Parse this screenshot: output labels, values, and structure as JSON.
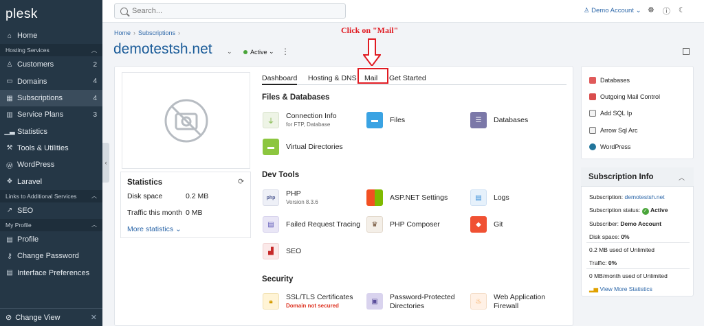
{
  "sidebar": {
    "logo": "plesk",
    "home": "Home",
    "sections": {
      "hosting": "Hosting Services",
      "links": "Links to Additional Services",
      "profile": "My Profile"
    },
    "items": [
      {
        "label": "Customers",
        "count": "2"
      },
      {
        "label": "Domains",
        "count": "4"
      },
      {
        "label": "Subscriptions",
        "count": "4"
      },
      {
        "label": "Service Plans",
        "count": "3"
      },
      {
        "label": "Statistics"
      },
      {
        "label": "Tools & Utilities"
      },
      {
        "label": "WordPress"
      },
      {
        "label": "Laravel"
      }
    ],
    "seo": "SEO",
    "profile_items": [
      "Profile",
      "Change Password",
      "Interface Preferences"
    ],
    "change_view": "Change View"
  },
  "topbar": {
    "search_placeholder": "Search...",
    "account": "Demo Account"
  },
  "breadcrumb": [
    "Home",
    "Subscriptions"
  ],
  "domain": "demotestsh.net",
  "status": "Active",
  "annotation": "Click on \"Mail\"",
  "tabs": [
    "Dashboard",
    "Hosting & DNS",
    "Mail",
    "Get Started"
  ],
  "statistics": {
    "title": "Statistics",
    "disk_label": "Disk space",
    "disk_value": "0.2 MB",
    "traffic_label": "Traffic this month",
    "traffic_value": "0 MB",
    "more": "More statistics"
  },
  "files_db": {
    "title": "Files & Databases",
    "tools": [
      {
        "label": "Connection Info",
        "sub": "for FTP, Database"
      },
      {
        "label": "Files"
      },
      {
        "label": "Databases"
      },
      {
        "label": "Virtual Directories"
      }
    ]
  },
  "dev_tools": {
    "title": "Dev Tools",
    "tools": [
      {
        "label": "PHP",
        "sub": "Version 8.3.6"
      },
      {
        "label": "ASP.NET Settings"
      },
      {
        "label": "Logs"
      },
      {
        "label": "Failed Request Tracing"
      },
      {
        "label": "PHP Composer"
      },
      {
        "label": "Git"
      },
      {
        "label": "SEO"
      }
    ]
  },
  "security": {
    "title": "Security",
    "tools": [
      {
        "label": "SSL/TLS Certificates",
        "sub": "Domain not secured"
      },
      {
        "label": "Password-Protected Directories"
      },
      {
        "label": "Web Application Firewall"
      }
    ]
  },
  "right_links": [
    "Databases",
    "Outgoing Mail Control",
    "Add SQL Ip",
    "Arrow Sql Arc",
    "WordPress"
  ],
  "subscription_info": {
    "title": "Subscription Info",
    "subscription_label": "Subscription:",
    "subscription_value": "demotestsh.net",
    "status_label": "Subscription status:",
    "status_value": "Active",
    "subscriber_label": "Subscriber:",
    "subscriber_value": "Demo Account",
    "disk_label": "Disk space:",
    "disk_value": "0%",
    "disk_used": "0.2 MB used of Unlimited",
    "traffic_label": "Traffic:",
    "traffic_value": "0%",
    "traffic_used": "0 MB/month used of Unlimited",
    "view_more": "View More Statistics"
  },
  "colors": {
    "sidebar_bg": "#253746",
    "link": "#2b66a8",
    "annotation": "#e01b22",
    "active_dot": "#4aa53a"
  }
}
